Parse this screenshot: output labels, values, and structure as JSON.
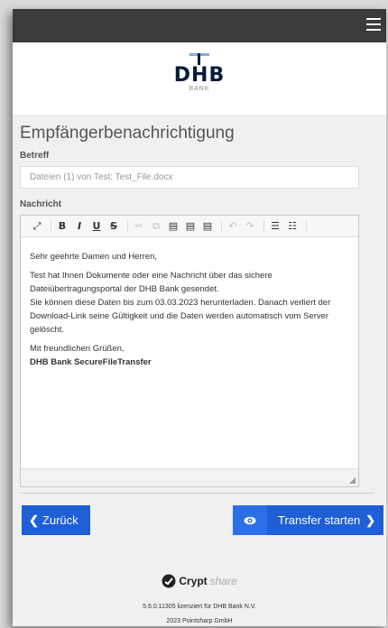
{
  "header": {
    "menu_icon": "hamburger-menu-icon"
  },
  "logo": {
    "text": "DHB",
    "sub": "BANK"
  },
  "page": {
    "title": "Empfängerbenachrichtigung"
  },
  "subject": {
    "label": "Betreff",
    "value": "Dateien (1) von Test: Test_File.docx"
  },
  "message": {
    "label": "Nachricht",
    "toolbar": {
      "items": [
        "expand-icon",
        "bold-icon",
        "italic-icon",
        "underline-icon",
        "strikethrough-icon",
        "cut-icon",
        "copy-icon",
        "paste-icon",
        "paste-text-icon",
        "paste-word-icon",
        "undo-icon",
        "redo-icon",
        "numbered-list-icon",
        "bulleted-list-icon"
      ]
    },
    "body": {
      "greeting": "Sehr geehrte Damen und Herren,",
      "para1_line1": "Test hat Ihnen Dokumente oder eine Nachricht über das sichere",
      "para1_line2": "Dateiübertragungsportal der DHB Bank gesendet.",
      "para1_line3": "Sie können diese Daten bis zum 03.03.2023 herunterladen. Danach verliert der",
      "para1_line4": "Download-Link seine Gültigkeit und die Daten werden automatisch vom Server",
      "para1_line5": "gelöscht.",
      "closing": "Mit freundlichen Grüßen,",
      "signature": "DHB Bank SecureFileTransfer"
    }
  },
  "buttons": {
    "back": "Zurück",
    "transfer": "Transfer starten"
  },
  "footer": {
    "brand_crypt": "Crypt",
    "brand_share": "share",
    "license": "5.6.0.11305 lizenziert für DHB Bank N.V.",
    "copyright": "2023 Pointsharp GmbH"
  },
  "colors": {
    "accent": "#1f5fd6",
    "topbar": "#3b3b3b"
  }
}
